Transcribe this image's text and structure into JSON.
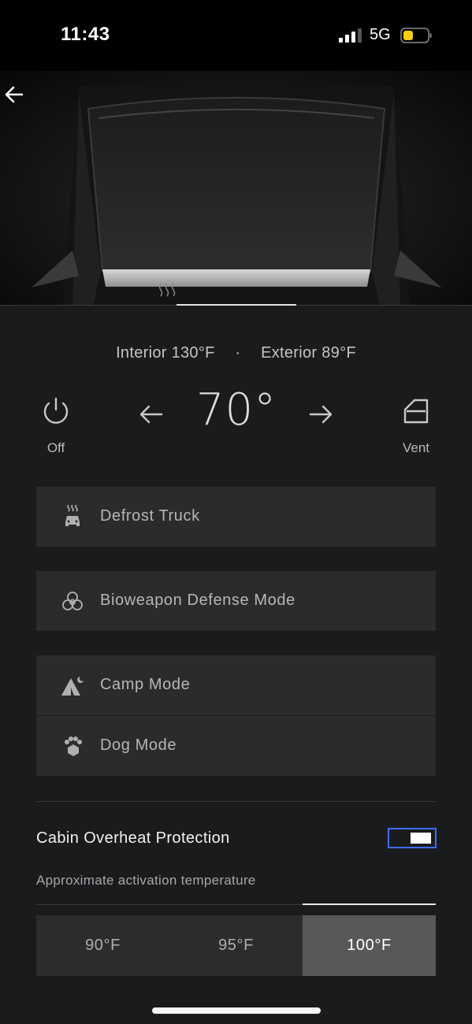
{
  "status_bar": {
    "time": "11:43",
    "network": "5G",
    "battery_color": "#f5cf16",
    "signal_bars_active": 3
  },
  "hero": {
    "back_icon": "arrow-left-icon"
  },
  "climate": {
    "interior_label": "Interior 130°F",
    "separator": "·",
    "exterior_label": "Exterior 89°F",
    "setpoint": "70°",
    "power_label": "Off",
    "vent_label": "Vent"
  },
  "modes": [
    {
      "label": "Defrost Truck",
      "icon": "defrost-truck-icon"
    },
    {
      "label": "Bioweapon Defense Mode",
      "icon": "biohazard-icon"
    },
    {
      "label": "Camp Mode",
      "icon": "tent-icon"
    },
    {
      "label": "Dog Mode",
      "icon": "paw-icon"
    }
  ],
  "overheat": {
    "title": "Cabin Overheat Protection",
    "enabled": true,
    "subtitle": "Approximate activation temperature",
    "options": [
      "90°F",
      "95°F",
      "100°F"
    ],
    "selected": "100°F"
  },
  "colors": {
    "panel": "#1a1b1d",
    "row": "#2a2b2d",
    "accent_blue": "#3e6dff",
    "selected_seg": "#585859"
  }
}
